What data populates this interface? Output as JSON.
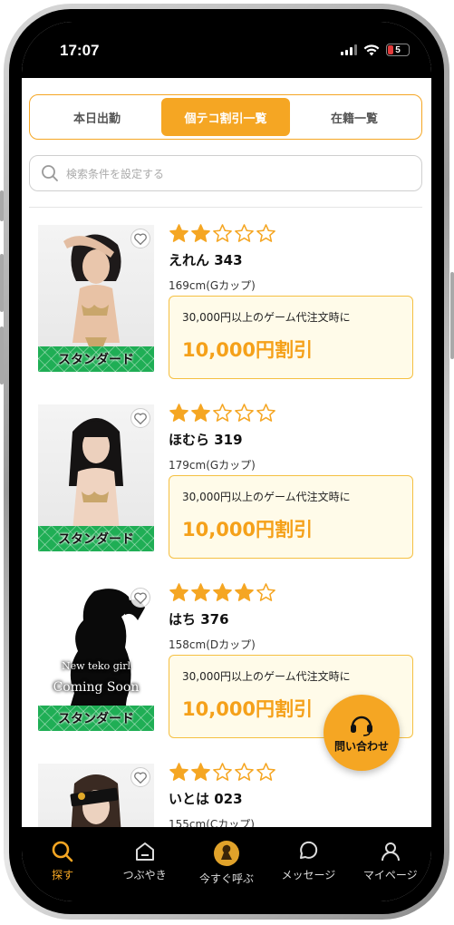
{
  "status": {
    "time": "17:07",
    "battery": "5"
  },
  "tabs": [
    {
      "label": "本日出勤",
      "active": false
    },
    {
      "label": "個テコ割引一覧",
      "active": true
    },
    {
      "label": "在籍一覧",
      "active": false
    }
  ],
  "search": {
    "placeholder": "検索条件を設定する"
  },
  "cards": [
    {
      "name": "えれん 343",
      "size": "169cm(Gカップ)",
      "rating": 2,
      "badge": "スタンダード",
      "offer_condition": "30,000円以上のゲーム代注文時に",
      "offer_amount": "10,000円割引"
    },
    {
      "name": "ほむら 319",
      "size": "179cm(Gカップ)",
      "rating": 2,
      "badge": "スタンダード",
      "offer_condition": "30,000円以上のゲーム代注文時に",
      "offer_amount": "10,000円割引"
    },
    {
      "name": "はち 376",
      "size": "158cm(Dカップ)",
      "rating": 4,
      "badge": "スタンダード",
      "photo_text_1": "New teko girl",
      "photo_text_2": "Coming Soon",
      "offer_condition": "30,000円以上のゲーム代注文時に",
      "offer_amount": "10,000円割引"
    },
    {
      "name": "いとは 023",
      "size": "155cm(Cカップ)",
      "rating": 2
    }
  ],
  "fab": {
    "label": "問い合わせ"
  },
  "nav": [
    {
      "label": "探す",
      "icon": "search-icon",
      "active": true
    },
    {
      "label": "つぶやき",
      "icon": "home-icon",
      "active": false
    },
    {
      "label": "今すぐ呼ぶ",
      "icon": "call-now-icon",
      "active": false
    },
    {
      "label": "メッセージ",
      "icon": "message-icon",
      "active": false
    },
    {
      "label": "マイページ",
      "icon": "user-icon",
      "active": false
    }
  ],
  "colors": {
    "accent": "#f5a623",
    "badge_green": "#1fae55",
    "offer_bg": "#fffbe9"
  }
}
